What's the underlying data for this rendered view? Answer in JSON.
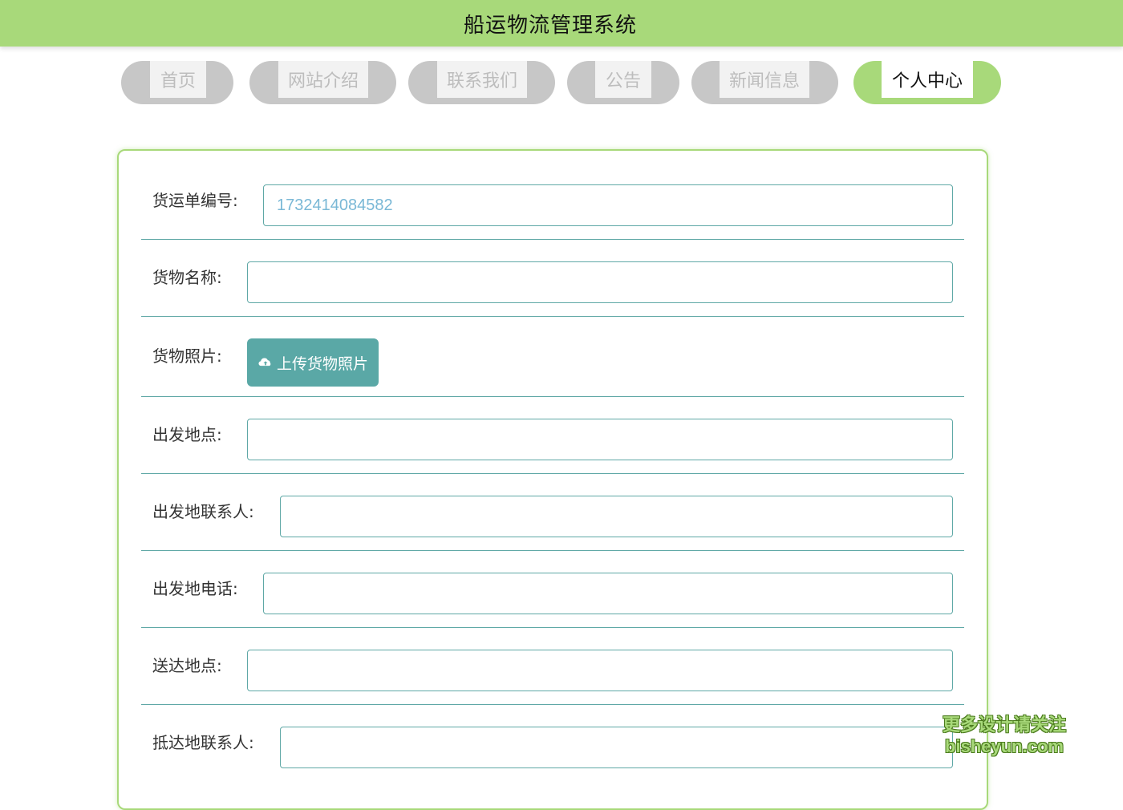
{
  "app_title": "船运物流管理系统",
  "nav": [
    {
      "label": "首页",
      "active": false
    },
    {
      "label": "网站介绍",
      "active": false
    },
    {
      "label": "联系我们",
      "active": false
    },
    {
      "label": "公告",
      "active": false
    },
    {
      "label": "新闻信息",
      "active": false
    },
    {
      "label": "个人中心",
      "active": true
    }
  ],
  "form": {
    "order_no": {
      "label": "货运单编号:",
      "value": "1732414084582"
    },
    "goods_name": {
      "label": "货物名称:",
      "value": ""
    },
    "goods_photo": {
      "label": "货物照片:",
      "button": "上传货物照片",
      "icon": "cloud-upload-icon"
    },
    "departure": {
      "label": "出发地点:",
      "value": ""
    },
    "departure_contact": {
      "label": "出发地联系人:",
      "value": ""
    },
    "departure_phone": {
      "label": "出发地电话:",
      "value": ""
    },
    "destination": {
      "label": "送达地点:",
      "value": ""
    },
    "arrival_contact": {
      "label": "抵达地联系人:",
      "value": ""
    }
  },
  "watermark": {
    "line1": "更多设计请关注",
    "line2": "bisheyun.com"
  },
  "colors": {
    "accent": "#a8d97a",
    "teal": "#5aa8a6",
    "border": "#5fa8a6",
    "nav_inactive": "#c7c7c7"
  }
}
